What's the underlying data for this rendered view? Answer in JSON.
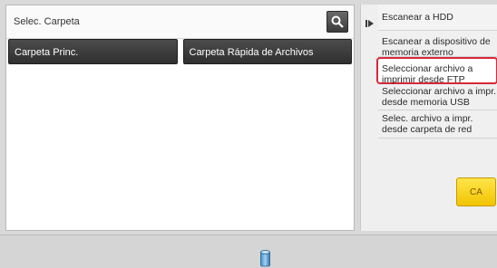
{
  "main": {
    "title": "Selec. Carpeta",
    "search_icon": "search-icon",
    "folders": [
      {
        "label": "Carpeta Princ."
      },
      {
        "label": "Carpeta Rápida de Archivos"
      }
    ]
  },
  "sidebar": {
    "arrow_icon": "expand-arrow-icon",
    "items": [
      {
        "label": "Escanear a HDD"
      },
      {
        "label": "Escanear a dispositivo de memoria externo"
      },
      {
        "label": "Seleccionar archivo a imprimir desde FTP",
        "selected": true
      },
      {
        "label": "Seleccionar archivo a impr. desde memoria USB"
      },
      {
        "label": "Selec. archivo a impr. desde carpeta de red"
      }
    ],
    "ca_label": "CA"
  },
  "bottom": {
    "icon": "storage-icon"
  },
  "colors": {
    "selection_border": "#d7283a",
    "ca_button": "#f1c400"
  }
}
